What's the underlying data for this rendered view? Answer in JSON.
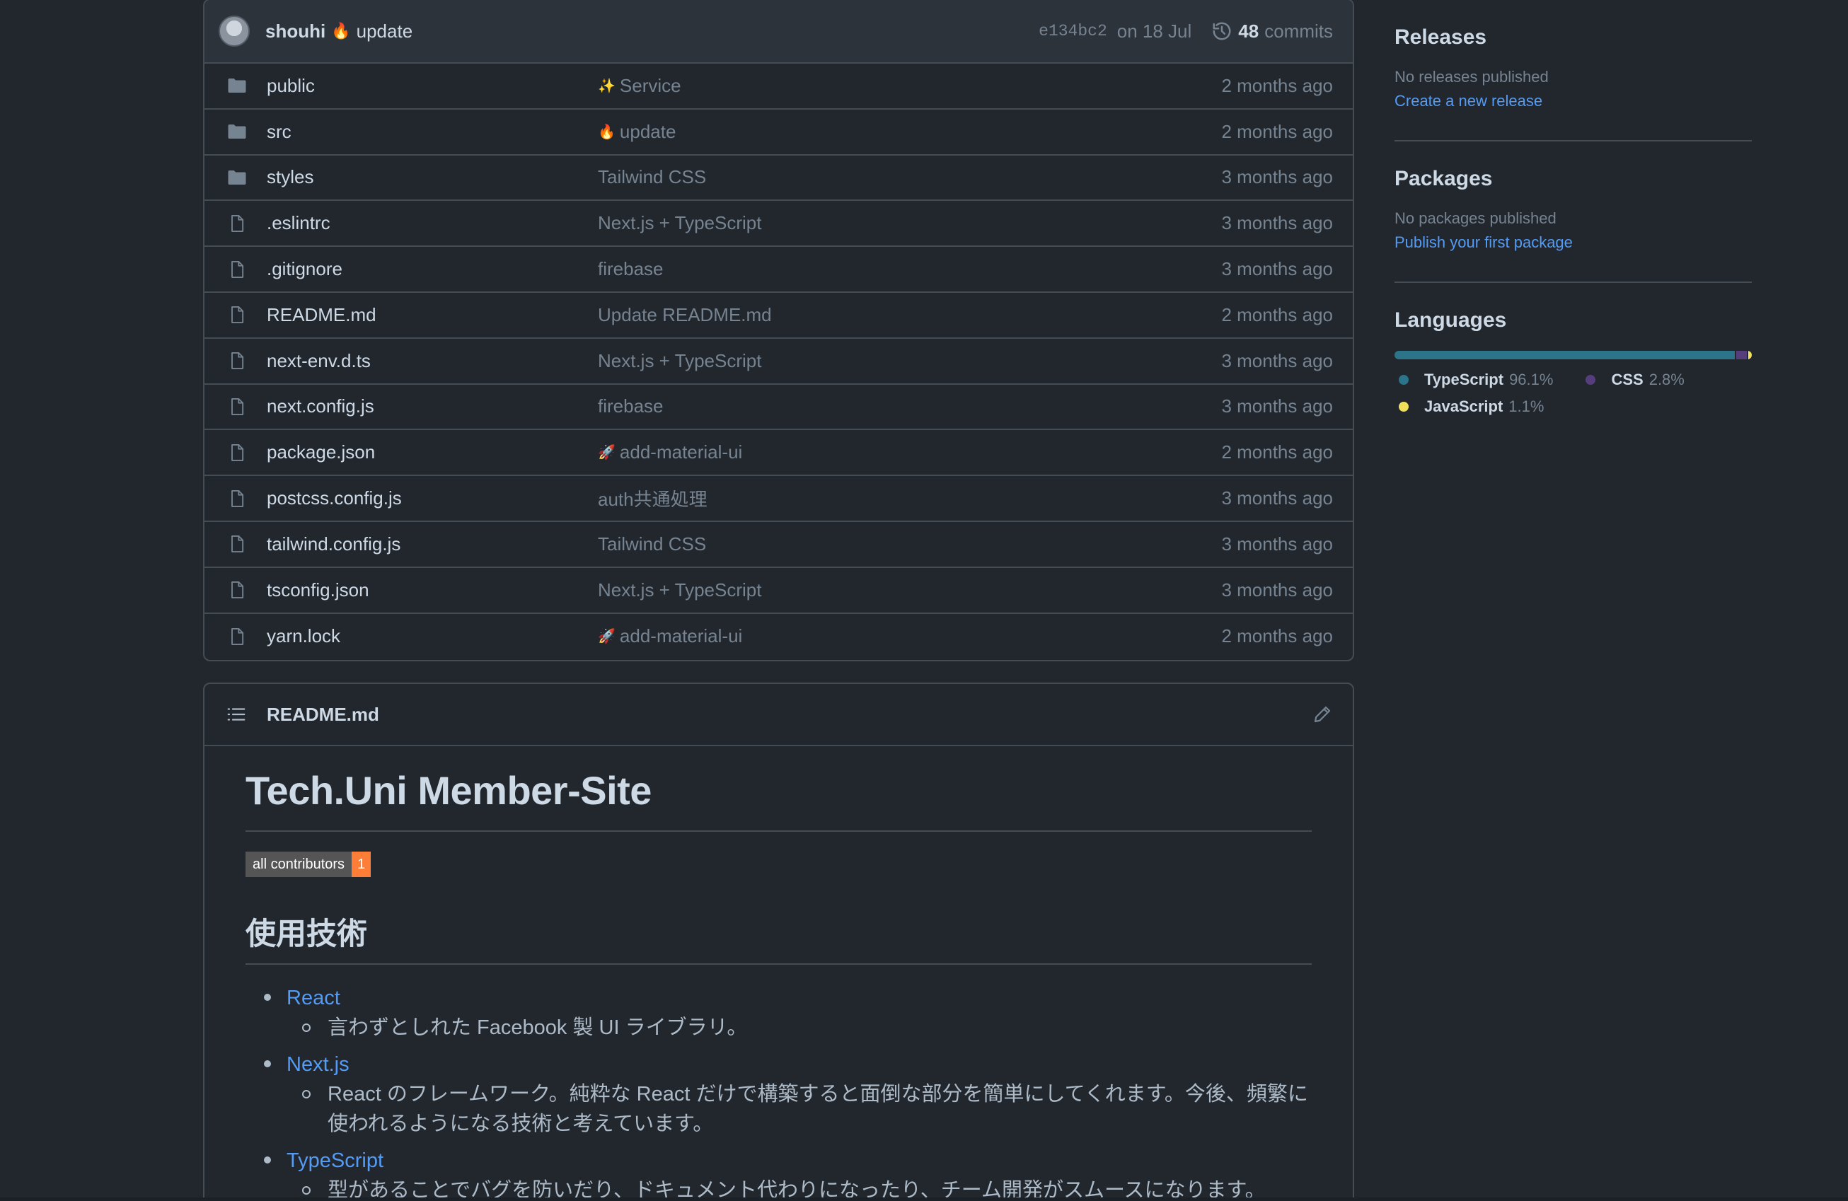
{
  "latest_commit": {
    "author": "shouhi",
    "emoji": "🔥",
    "message": "update",
    "sha": "e134bc2",
    "date": "on 18 Jul",
    "commits_count": "48",
    "commits_label": "commits"
  },
  "files": [
    {
      "type": "folder",
      "name": "public",
      "emoji": "✨",
      "commit": "Service",
      "age": "2 months ago"
    },
    {
      "type": "folder",
      "name": "src",
      "emoji": "🔥",
      "commit": "update",
      "age": "2 months ago"
    },
    {
      "type": "folder",
      "name": "styles",
      "emoji": "",
      "commit": "Tailwind CSS",
      "age": "3 months ago"
    },
    {
      "type": "file",
      "name": ".eslintrc",
      "emoji": "",
      "commit": "Next.js + TypeScript",
      "age": "3 months ago"
    },
    {
      "type": "file",
      "name": ".gitignore",
      "emoji": "",
      "commit": "firebase",
      "age": "3 months ago"
    },
    {
      "type": "file",
      "name": "README.md",
      "emoji": "",
      "commit": "Update README.md",
      "age": "2 months ago"
    },
    {
      "type": "file",
      "name": "next-env.d.ts",
      "emoji": "",
      "commit": "Next.js + TypeScript",
      "age": "3 months ago"
    },
    {
      "type": "file",
      "name": "next.config.js",
      "emoji": "",
      "commit": "firebase",
      "age": "3 months ago"
    },
    {
      "type": "file",
      "name": "package.json",
      "emoji": "🚀",
      "commit": "add-material-ui",
      "age": "2 months ago"
    },
    {
      "type": "file",
      "name": "postcss.config.js",
      "emoji": "",
      "commit": "auth共通処理",
      "age": "3 months ago"
    },
    {
      "type": "file",
      "name": "tailwind.config.js",
      "emoji": "",
      "commit": "Tailwind CSS",
      "age": "3 months ago"
    },
    {
      "type": "file",
      "name": "tsconfig.json",
      "emoji": "",
      "commit": "Next.js + TypeScript",
      "age": "3 months ago"
    },
    {
      "type": "file",
      "name": "yarn.lock",
      "emoji": "🚀",
      "commit": "add-material-ui",
      "age": "2 months ago"
    }
  ],
  "readme": {
    "filename": "README.md",
    "title": "Tech.Uni Member-Site",
    "badge_label": "all contributors",
    "badge_count": "1",
    "section_heading": "使用技術",
    "tech": [
      {
        "name": "React",
        "desc": [
          "言わずとしれた Facebook 製 UI ライブラリ。"
        ]
      },
      {
        "name": "Next.js",
        "desc": [
          "React のフレームワーク。純粋な React だけで構築すると面倒な部分を簡単にしてくれます。今後、頻繁に",
          "使われるようになる技術と考えています。"
        ]
      },
      {
        "name": "TypeScript",
        "desc": [
          "型があることでバグを防いだり、ドキュメント代わりになったり、チーム開発がスムースになります。"
        ]
      }
    ]
  },
  "sidebar": {
    "releases": {
      "title": "Releases",
      "status": "No releases published",
      "link": "Create a new release"
    },
    "packages": {
      "title": "Packages",
      "status": "No packages published",
      "link": "Publish your first package"
    },
    "languages": {
      "title": "Languages",
      "items": [
        {
          "name": "TypeScript",
          "percent": 96.1,
          "label": "96.1%",
          "color": "#2b7489"
        },
        {
          "name": "CSS",
          "percent": 2.8,
          "label": "2.8%",
          "color": "#563d7c"
        },
        {
          "name": "JavaScript",
          "percent": 1.1,
          "label": "1.1%",
          "color": "#f1e05a"
        }
      ]
    }
  },
  "colors": {
    "background": "#22272e",
    "border": "#444c56",
    "link": "#539bf5",
    "muted": "#768390",
    "text": "#cdd9e5"
  }
}
